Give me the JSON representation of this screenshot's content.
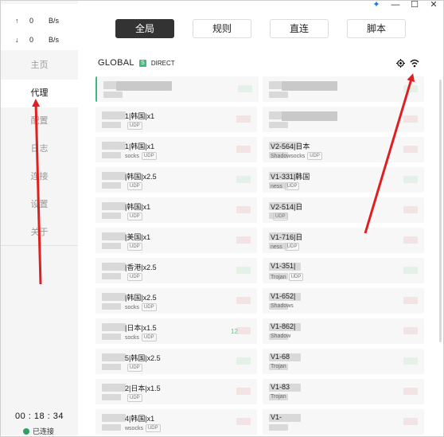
{
  "window": {
    "pin": "✦",
    "minimize": "—",
    "maximize": "☐",
    "close": "✕"
  },
  "traffic": {
    "up": {
      "arrow": "↑",
      "value": "0",
      "unit": "B/s"
    },
    "down": {
      "arrow": "↓",
      "value": "0",
      "unit": "B/s"
    }
  },
  "nav": [
    "主页",
    "代理",
    "配置",
    "日志",
    "连接",
    "设置",
    "关于"
  ],
  "nav_active": "代理",
  "clock": "00 : 18 : 34",
  "status": "已连接",
  "tabs": [
    "全局",
    "规则",
    "直连",
    "脚本"
  ],
  "tab_active": "全局",
  "group": {
    "name": "GLOBAL",
    "badge": "S",
    "selected": "DIRECT"
  },
  "left_items": [
    {
      "name": "",
      "proto": "",
      "udp": ""
    },
    {
      "name": "1|韩国|x1",
      "proto": "",
      "udp": "UDP"
    },
    {
      "name": "1|韩国|x1",
      "proto": "socks",
      "udp": "UDP"
    },
    {
      "name": "|韩国|x2.5",
      "proto": "",
      "udp": "UDP"
    },
    {
      "name": "|韩国|x1",
      "proto": "",
      "udp": "UDP"
    },
    {
      "name": "|美国|x1",
      "proto": "",
      "udp": "UDP"
    },
    {
      "name": "|香港|x2.5",
      "proto": "",
      "udp": "UDP"
    },
    {
      "name": "|韩国|x2.5",
      "proto": "socks",
      "udp": "UDP"
    },
    {
      "name": "|日本|x1.5",
      "proto": "socks",
      "udp": "UDP"
    },
    {
      "name": "5|韩国|x2.5",
      "proto": "",
      "udp": "UDP"
    },
    {
      "name": "2|日本|x1.5",
      "proto": "",
      "udp": "UDP"
    },
    {
      "name": "4|韩国|x1",
      "proto": "wsocks",
      "udp": "UDP"
    }
  ],
  "right_items": [
    {
      "name": "",
      "proto": "",
      "udp": ""
    },
    {
      "name": "",
      "proto": "",
      "udp": ""
    },
    {
      "name": "V2-564|日本",
      "proto": "Shadowsocks",
      "udp": "UDP"
    },
    {
      "name": "V1-331|韩国",
      "proto": "ness",
      "udp": "UDP"
    },
    {
      "name": "V2-514|日",
      "proto": "",
      "udp": "UDP"
    },
    {
      "name": "V1-716|日",
      "proto": "ness",
      "udp": "UDP"
    },
    {
      "name": "V1-351|",
      "proto": "Trojan",
      "udp": "UDP"
    },
    {
      "name": "V1-652|",
      "proto": "Shadows",
      "udp": ""
    },
    {
      "name": "V1-862|",
      "proto": "Shadow",
      "udp": ""
    },
    {
      "name": "V1-68",
      "proto": "Trojan",
      "udp": ""
    },
    {
      "name": "V1-83",
      "proto": "Trojan",
      "udp": ""
    },
    {
      "name": "V1-",
      "proto": "",
      "udp": ""
    }
  ],
  "row8_extra": "12",
  "colors": {
    "accent": "#3dbb7c",
    "tab_active_bg": "#333333",
    "arrow": "#e02020",
    "status_dot": "#2ea064"
  },
  "icons": {
    "locate": "locate-icon",
    "latency_test": "wifi-icon",
    "pin": "pin-icon"
  }
}
